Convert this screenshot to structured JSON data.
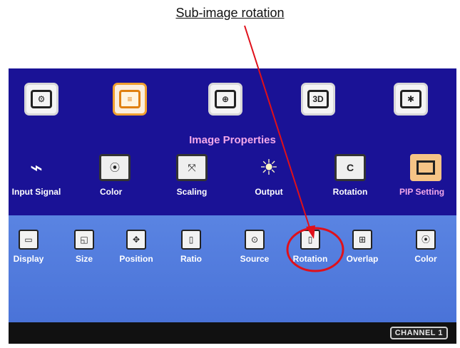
{
  "annotation": {
    "caption": "Sub-image rotation",
    "marker_color": "#e0101a"
  },
  "top_menu": [
    {
      "icon": "palette-icon",
      "glyph": "⚙",
      "active": false
    },
    {
      "icon": "slider-bars-icon",
      "glyph": "≡",
      "active": true
    },
    {
      "icon": "globe-icon",
      "glyph": "⊕",
      "active": false
    },
    {
      "icon": "3d-cube-icon",
      "glyph": "3D",
      "active": false
    },
    {
      "icon": "gear-icon",
      "glyph": "✱",
      "active": false
    }
  ],
  "section_title": "Image Properties",
  "categories": [
    {
      "label": "Input Signal",
      "icon": "usb-plug-icon",
      "glyph": "⌁",
      "active": false
    },
    {
      "label": "Color",
      "icon": "color-dots-icon",
      "glyph": "⦿",
      "active": false
    },
    {
      "label": "Scaling",
      "icon": "scaling-arrows-icon",
      "glyph": "⤧",
      "active": false
    },
    {
      "label": "Output",
      "icon": "output-sun-icon",
      "glyph": "☀",
      "active": false
    },
    {
      "label": "Rotation",
      "icon": "rotation-icon",
      "glyph": "C",
      "active": false
    },
    {
      "label": "PIP Setting",
      "icon": "pip-window-icon",
      "glyph": "",
      "active": true
    }
  ],
  "pip_submenu": [
    {
      "label": "Display",
      "icon": "display-icon",
      "glyph": "▭"
    },
    {
      "label": "Size",
      "icon": "size-icon",
      "glyph": "◱"
    },
    {
      "label": "Position",
      "icon": "position-icon",
      "glyph": "✥"
    },
    {
      "label": "Ratio",
      "icon": "ratio-icon",
      "glyph": "▯"
    },
    {
      "label": "Source",
      "icon": "source-icon",
      "glyph": "⊙"
    },
    {
      "label": "Rotation",
      "icon": "sub-rotation-icon",
      "glyph": "▯"
    },
    {
      "label": "Overlap",
      "icon": "overlap-icon",
      "glyph": "⊞"
    },
    {
      "label": "Color",
      "icon": "sub-color-icon",
      "glyph": "⦿"
    }
  ],
  "status": {
    "channel": "CHANNEL 1"
  }
}
